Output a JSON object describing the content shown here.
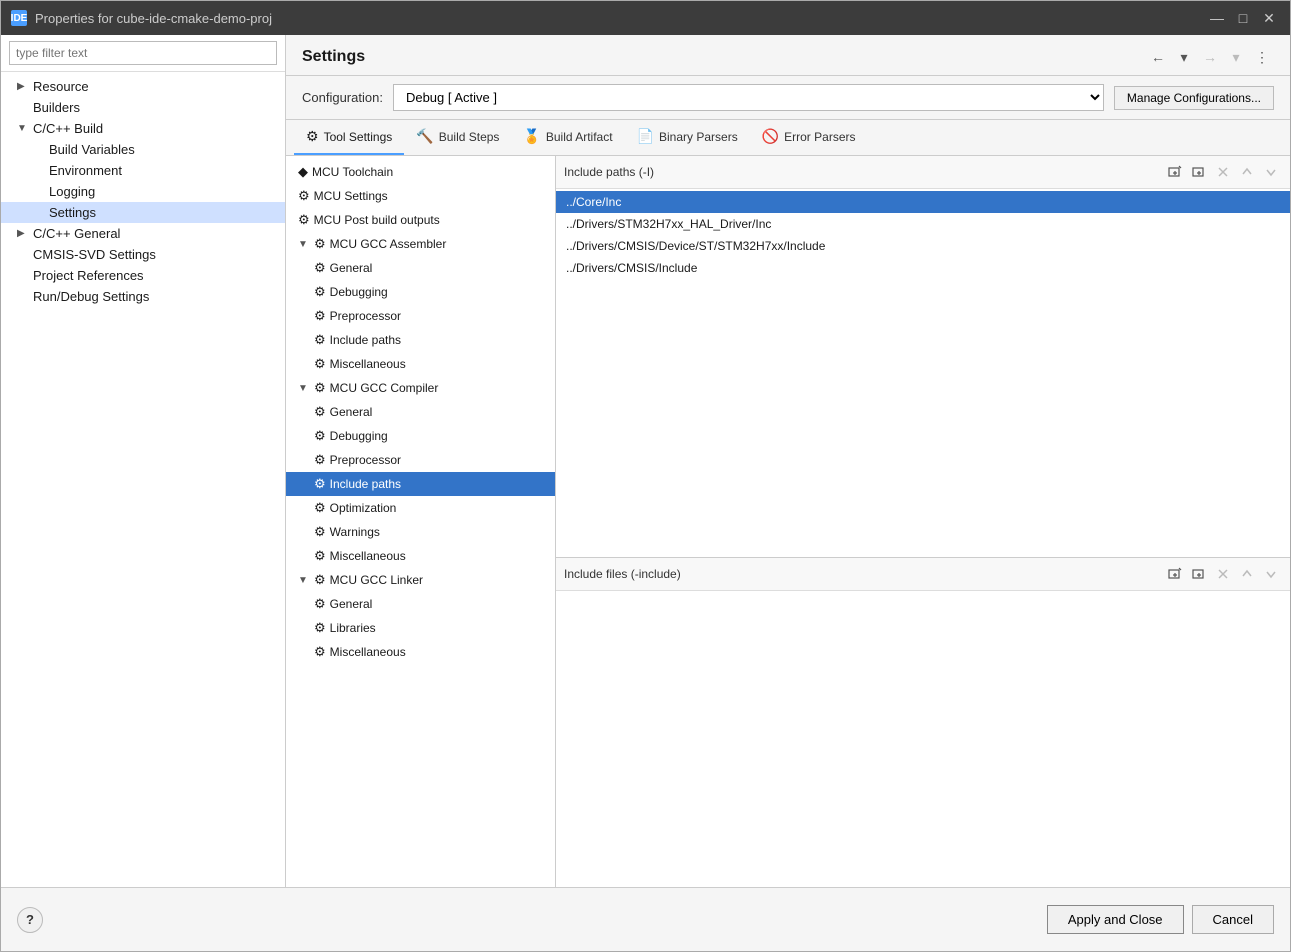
{
  "window": {
    "title": "Properties for cube-ide-cmake-demo-proj",
    "icon_label": "IDE"
  },
  "filter": {
    "placeholder": "type filter text"
  },
  "nav_tree": [
    {
      "id": "resource",
      "label": "Resource",
      "level": 1,
      "expandable": true,
      "expanded": false,
      "icon": "▶"
    },
    {
      "id": "builders",
      "label": "Builders",
      "level": 1,
      "expandable": false,
      "icon": ""
    },
    {
      "id": "cpp-build",
      "label": "C/C++ Build",
      "level": 1,
      "expandable": true,
      "expanded": true,
      "icon": "▼"
    },
    {
      "id": "build-vars",
      "label": "Build Variables",
      "level": 2,
      "expandable": false,
      "icon": ""
    },
    {
      "id": "environment",
      "label": "Environment",
      "level": 2,
      "expandable": false,
      "icon": ""
    },
    {
      "id": "logging",
      "label": "Logging",
      "level": 2,
      "expandable": false,
      "icon": ""
    },
    {
      "id": "settings",
      "label": "Settings",
      "level": 2,
      "expandable": false,
      "icon": "",
      "selected": true
    },
    {
      "id": "cpp-general",
      "label": "C/C++ General",
      "level": 1,
      "expandable": true,
      "expanded": false,
      "icon": "▶"
    },
    {
      "id": "cmsis-svd",
      "label": "CMSIS-SVD Settings",
      "level": 1,
      "expandable": false,
      "icon": ""
    },
    {
      "id": "project-refs",
      "label": "Project References",
      "level": 1,
      "expandable": false,
      "icon": ""
    },
    {
      "id": "run-debug",
      "label": "Run/Debug Settings",
      "level": 1,
      "expandable": false,
      "icon": ""
    }
  ],
  "settings": {
    "title": "Settings",
    "configuration_label": "Configuration:",
    "configuration_value": "Debug  [ Active ]",
    "manage_btn_label": "Manage Configurations..."
  },
  "tabs": [
    {
      "id": "tool-settings",
      "label": "Tool Settings",
      "icon": "⚙",
      "active": true
    },
    {
      "id": "build-steps",
      "label": "Build Steps",
      "icon": "🔨"
    },
    {
      "id": "build-artifact",
      "label": "Build Artifact",
      "icon": "🏅"
    },
    {
      "id": "binary-parsers",
      "label": "Binary Parsers",
      "icon": "📄"
    },
    {
      "id": "error-parsers",
      "label": "Error Parsers",
      "icon": "🚫"
    }
  ],
  "tool_tree": [
    {
      "id": "mcu-toolchain",
      "label": "MCU Toolchain",
      "level": 1,
      "icon": "◆",
      "expandable": false
    },
    {
      "id": "mcu-settings",
      "label": "MCU Settings",
      "level": 1,
      "icon": "⚙",
      "expandable": false
    },
    {
      "id": "mcu-post-build",
      "label": "MCU Post build outputs",
      "level": 1,
      "icon": "⚙",
      "expandable": false
    },
    {
      "id": "mcu-gcc-assembler",
      "label": "MCU GCC Assembler",
      "level": 1,
      "icon": "⚙",
      "expandable": true,
      "expanded": true,
      "arrow": "▼"
    },
    {
      "id": "asm-general",
      "label": "General",
      "level": 2,
      "icon": "⚙",
      "expandable": false
    },
    {
      "id": "asm-debugging",
      "label": "Debugging",
      "level": 2,
      "icon": "⚙",
      "expandable": false
    },
    {
      "id": "asm-preprocessor",
      "label": "Preprocessor",
      "level": 2,
      "icon": "⚙",
      "expandable": false
    },
    {
      "id": "asm-include-paths",
      "label": "Include paths",
      "level": 2,
      "icon": "⚙",
      "expandable": false
    },
    {
      "id": "asm-misc",
      "label": "Miscellaneous",
      "level": 2,
      "icon": "⚙",
      "expandable": false
    },
    {
      "id": "mcu-gcc-compiler",
      "label": "MCU GCC Compiler",
      "level": 1,
      "icon": "⚙",
      "expandable": true,
      "expanded": true,
      "arrow": "▼"
    },
    {
      "id": "comp-general",
      "label": "General",
      "level": 2,
      "icon": "⚙",
      "expandable": false
    },
    {
      "id": "comp-debugging",
      "label": "Debugging",
      "level": 2,
      "icon": "⚙",
      "expandable": false
    },
    {
      "id": "comp-preprocessor",
      "label": "Preprocessor",
      "level": 2,
      "icon": "⚙",
      "expandable": false
    },
    {
      "id": "comp-include-paths",
      "label": "Include paths",
      "level": 2,
      "icon": "⚙",
      "expandable": false,
      "selected": true
    },
    {
      "id": "comp-optimization",
      "label": "Optimization",
      "level": 2,
      "icon": "⚙",
      "expandable": false
    },
    {
      "id": "comp-warnings",
      "label": "Warnings",
      "level": 2,
      "icon": "⚙",
      "expandable": false
    },
    {
      "id": "comp-misc",
      "label": "Miscellaneous",
      "level": 2,
      "icon": "⚙",
      "expandable": false
    },
    {
      "id": "mcu-gcc-linker",
      "label": "MCU GCC Linker",
      "level": 1,
      "icon": "⚙",
      "expandable": true,
      "expanded": true,
      "arrow": "▼"
    },
    {
      "id": "link-general",
      "label": "General",
      "level": 2,
      "icon": "⚙",
      "expandable": false
    },
    {
      "id": "link-libraries",
      "label": "Libraries",
      "level": 2,
      "icon": "⚙",
      "expandable": false
    },
    {
      "id": "link-misc",
      "label": "Miscellaneous",
      "level": 2,
      "icon": "⚙",
      "expandable": false
    }
  ],
  "include_paths_section": {
    "title": "Include paths (-I)",
    "paths": [
      {
        "id": "path1",
        "value": "../Core/Inc",
        "selected": true
      },
      {
        "id": "path2",
        "value": "../Drivers/STM32H7xx_HAL_Driver/Inc",
        "selected": false
      },
      {
        "id": "path3",
        "value": "../Drivers/CMSIS/Device/ST/STM32H7xx/Include",
        "selected": false
      },
      {
        "id": "path4",
        "value": "../Drivers/CMSIS/Include",
        "selected": false
      }
    ],
    "actions": [
      {
        "id": "add-external",
        "icon": "🔗",
        "tooltip": "Add external include path"
      },
      {
        "id": "add-workspace",
        "icon": "📁",
        "tooltip": "Add workspace include path"
      },
      {
        "id": "delete",
        "icon": "✕",
        "tooltip": "Delete"
      },
      {
        "id": "move-up",
        "icon": "↑",
        "tooltip": "Move up"
      },
      {
        "id": "move-down",
        "icon": "↓",
        "tooltip": "Move down"
      }
    ]
  },
  "include_files_section": {
    "title": "Include files (-include)",
    "paths": [],
    "actions": [
      {
        "id": "add-external",
        "icon": "🔗",
        "tooltip": "Add external"
      },
      {
        "id": "add-workspace",
        "icon": "📁",
        "tooltip": "Add workspace"
      },
      {
        "id": "delete",
        "icon": "✕",
        "tooltip": "Delete"
      },
      {
        "id": "move-up",
        "icon": "↑",
        "tooltip": "Move up"
      },
      {
        "id": "move-down",
        "icon": "↓",
        "tooltip": "Move down"
      }
    ]
  },
  "bottom": {
    "help_label": "?",
    "apply_close_label": "Apply and Close",
    "cancel_label": "Cancel"
  }
}
